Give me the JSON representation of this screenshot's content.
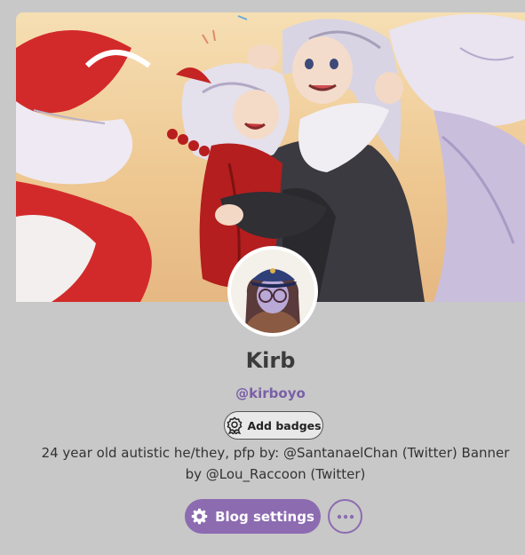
{
  "profile": {
    "title": "Kirb",
    "handle": "@kirboyo",
    "description": "24 year old autistic he/they, pfp by: @SantanaelChan (Twitter) Banner by @Lou_Raccoon (Twitter)"
  },
  "actions": {
    "add_badges_label": "Add badges",
    "blog_settings_label": "Blog settings"
  },
  "icons": {
    "badge": "badge-ribbon-icon",
    "settings": "gear-icon",
    "more": "ellipsis-icon"
  },
  "colors": {
    "accent": "#8c6bb1",
    "handle": "#7a5fa7",
    "background": "#c8c8c8",
    "title": "#3b3b3b"
  }
}
